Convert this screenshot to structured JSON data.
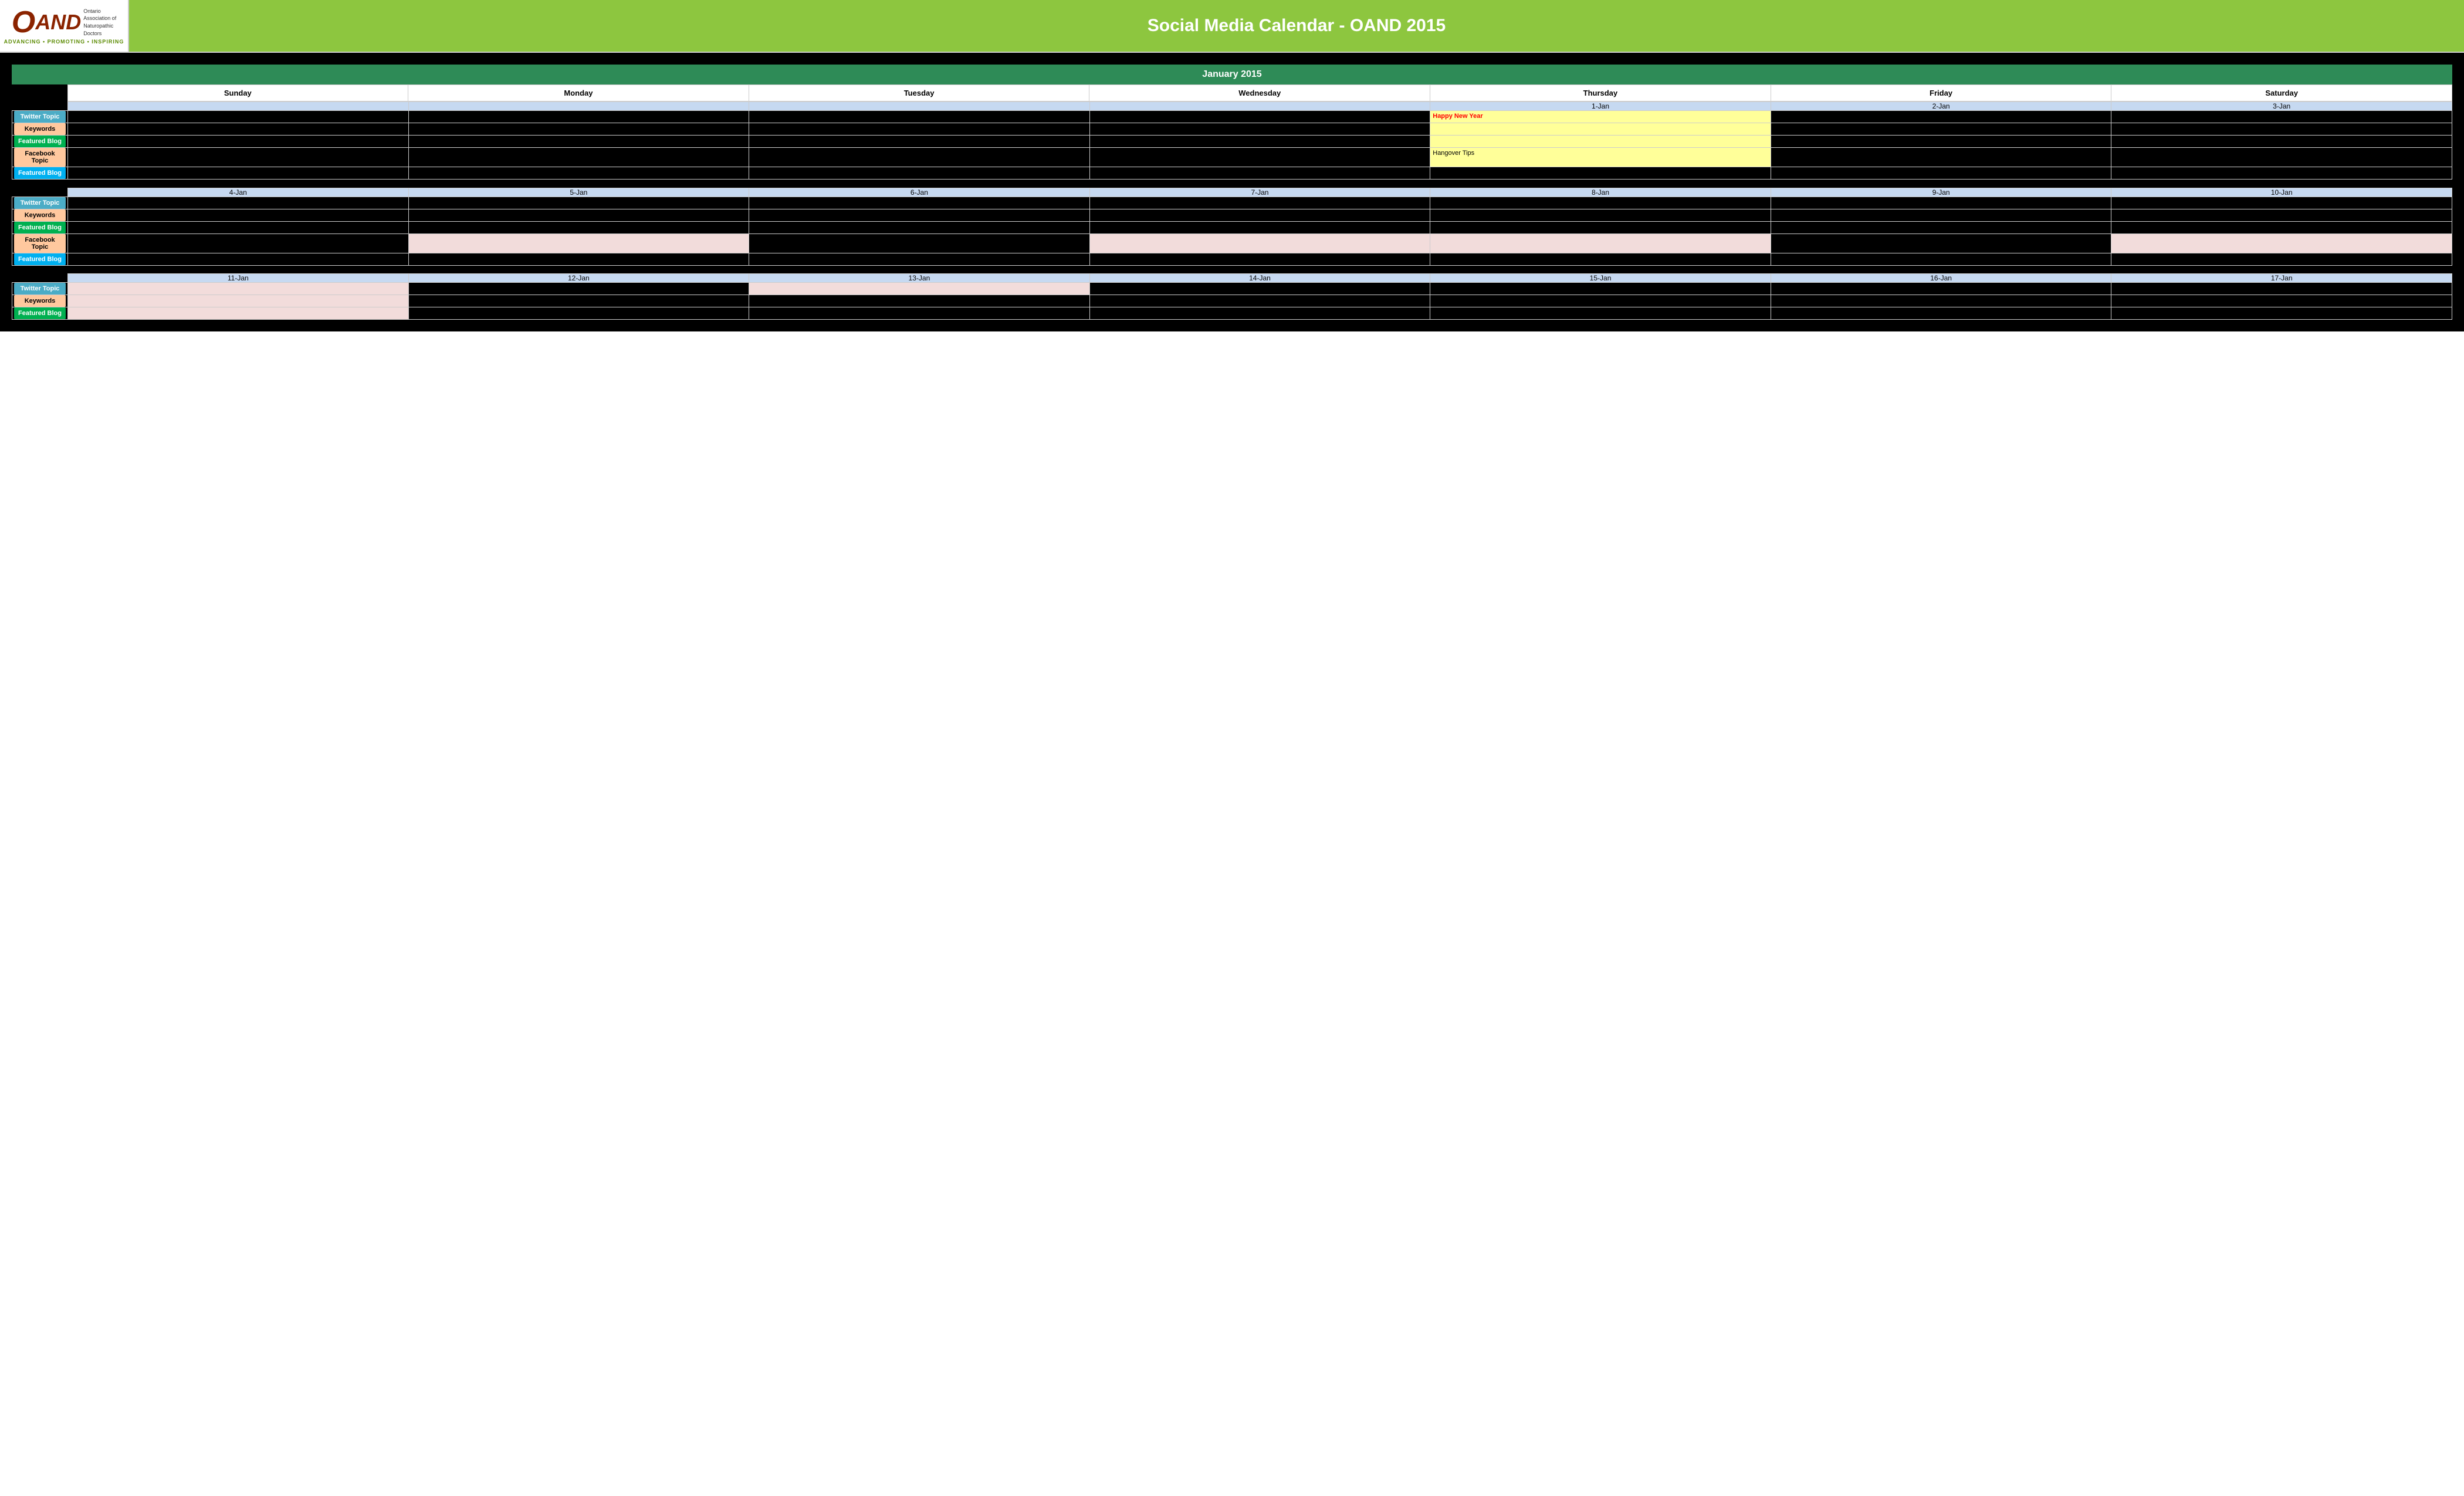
{
  "header": {
    "title": "Social Media Calendar - OAND 2015",
    "logo": {
      "o": "O",
      "and": "AND",
      "association_line1": "Ontario",
      "association_line2": "Association of",
      "association_line3": "Naturopathic",
      "association_line4": "Doctors",
      "tagline": "ADVANCING • PROMOTING • INSPIRING"
    }
  },
  "calendar": {
    "month": "January 2015",
    "days_of_week": [
      "Sunday",
      "Monday",
      "Tuesday",
      "Wednesday",
      "Thursday",
      "Friday",
      "Saturday"
    ],
    "row_labels": {
      "twitter": "Twitter Topic",
      "keywords": "Keywords",
      "featured_blog_green": "Featured Blog",
      "facebook": "Facebook Topic",
      "featured_blog_blue": "Featured Blog"
    },
    "weeks": [
      {
        "dates": [
          "",
          "",
          "",
          "",
          "1-Jan",
          "2-Jan",
          "3-Jan"
        ],
        "rows": {
          "twitter": [
            "",
            "",
            "",
            "",
            "yellow",
            "",
            ""
          ],
          "twitter_content": [
            "",
            "",
            "",
            "",
            "Happy New Year",
            "",
            ""
          ],
          "keywords": [
            "",
            "",
            "",
            "",
            "yellow",
            "",
            ""
          ],
          "featured": [
            "",
            "",
            "",
            "",
            "yellow",
            "",
            ""
          ],
          "facebook": [
            "",
            "",
            "",
            "",
            "yellow",
            "",
            ""
          ],
          "facebook_content": [
            "",
            "",
            "",
            "",
            "Hangover Tips",
            "",
            ""
          ],
          "featured2": [
            "",
            "",
            "",
            "",
            "",
            "",
            ""
          ]
        }
      },
      {
        "dates": [
          "4-Jan",
          "5-Jan",
          "6-Jan",
          "7-Jan",
          "8-Jan",
          "9-Jan",
          "10-Jan"
        ],
        "rows": {
          "twitter": [
            "",
            "",
            "",
            "",
            "",
            "",
            ""
          ],
          "keywords": [
            "",
            "",
            "",
            "",
            "",
            "",
            ""
          ],
          "featured": [
            "",
            "",
            "",
            "",
            "",
            "",
            ""
          ],
          "facebook": [
            "",
            "pink",
            "",
            "pink",
            "pink",
            "",
            "pink"
          ],
          "facebook_content": [
            "",
            "",
            "",
            "",
            "",
            "",
            ""
          ],
          "featured2": [
            "",
            "",
            "",
            "",
            "",
            "",
            ""
          ]
        }
      },
      {
        "dates": [
          "11-Jan",
          "12-Jan",
          "13-Jan",
          "14-Jan",
          "15-Jan",
          "16-Jan",
          "17-Jan"
        ],
        "rows": {
          "twitter": [
            "pink",
            "",
            "pink",
            "",
            "",
            "",
            ""
          ],
          "keywords": [
            "pink",
            "",
            "",
            "",
            "",
            "",
            ""
          ],
          "featured": [
            "pink",
            "",
            "",
            "",
            "",
            "",
            ""
          ],
          "facebook": [
            "",
            "",
            "",
            "",
            "",
            "",
            ""
          ],
          "facebook_content": [
            "",
            "",
            "",
            "",
            "",
            "",
            ""
          ],
          "featured2": [
            "",
            "",
            "",
            "",
            "",
            "",
            ""
          ]
        }
      }
    ]
  }
}
